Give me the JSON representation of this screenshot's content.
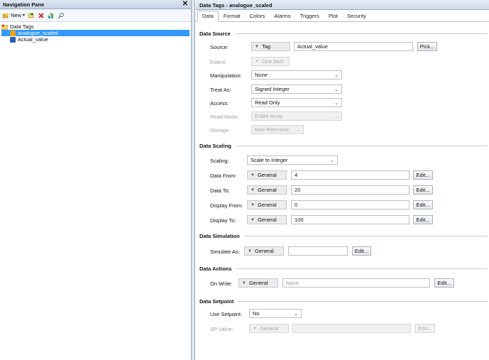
{
  "nav": {
    "title": "Navigation Pane",
    "close_glyph": "✕",
    "toolbar": {
      "new_label": "New",
      "icons": [
        "add-tag-icon",
        "delete-icon",
        "group-icon",
        "search-icon"
      ]
    },
    "tree": {
      "root": {
        "label": "Data Tags",
        "icon": "folder-tags-icon"
      },
      "items": [
        {
          "label": "analogue_scaled",
          "icon": "scaled-tag-icon",
          "selected": true,
          "color": "#e8a317"
        },
        {
          "label": "Actual_value",
          "icon": "tag-icon",
          "selected": false,
          "color": "#2a5db0"
        }
      ]
    }
  },
  "main": {
    "title": "Data Tags - analogue_scaled",
    "tabs": [
      "Data",
      "Format",
      "Colors",
      "Alarms",
      "Triggers",
      "Plot",
      "Security"
    ],
    "active_tab": "Data"
  },
  "data_source": {
    "heading": "Data Source",
    "source_label": "Source:",
    "source_type": "Tag",
    "source_value": "Actual_value",
    "pick_label": "Pick...",
    "extent_label": "Extent:",
    "extent_value": "One Item",
    "manipulation_label": "Manipulation:",
    "manipulation_value": "None",
    "treat_as_label": "Treat As:",
    "treat_as_value": "Signed Integer",
    "access_label": "Access:",
    "access_value": "Read Only",
    "read_mode_label": "Read Mode:",
    "read_mode_value": "Entire Array",
    "storage_label": "Storage:",
    "storage_value": "Non-Retentive"
  },
  "data_scaling": {
    "heading": "Data Scaling",
    "scaling_label": "Scaling:",
    "scaling_value": "Scale to Integer",
    "rows": [
      {
        "label": "Data From:",
        "type": "General",
        "value": "4",
        "edit": "Edit..."
      },
      {
        "label": "Data To:",
        "type": "General",
        "value": "20",
        "edit": "Edit..."
      },
      {
        "label": "Display From:",
        "type": "General",
        "value": "0",
        "edit": "Edit..."
      },
      {
        "label": "Display To:",
        "type": "General",
        "value": "100",
        "edit": "Edit..."
      }
    ]
  },
  "data_simulation": {
    "heading": "Data Simulation",
    "label": "Simulate As:",
    "type": "General",
    "value": "",
    "edit": "Edit..."
  },
  "data_actions": {
    "heading": "Data Actions",
    "label": "On Write:",
    "type": "General",
    "placeholder": "None",
    "edit": "Edit..."
  },
  "data_setpoint": {
    "heading": "Data Setpoint",
    "use_label": "Use Setpoint:",
    "use_value": "No",
    "sp_label": "SP Value:",
    "sp_type": "General",
    "sp_value": "",
    "edit": "Edit..."
  }
}
